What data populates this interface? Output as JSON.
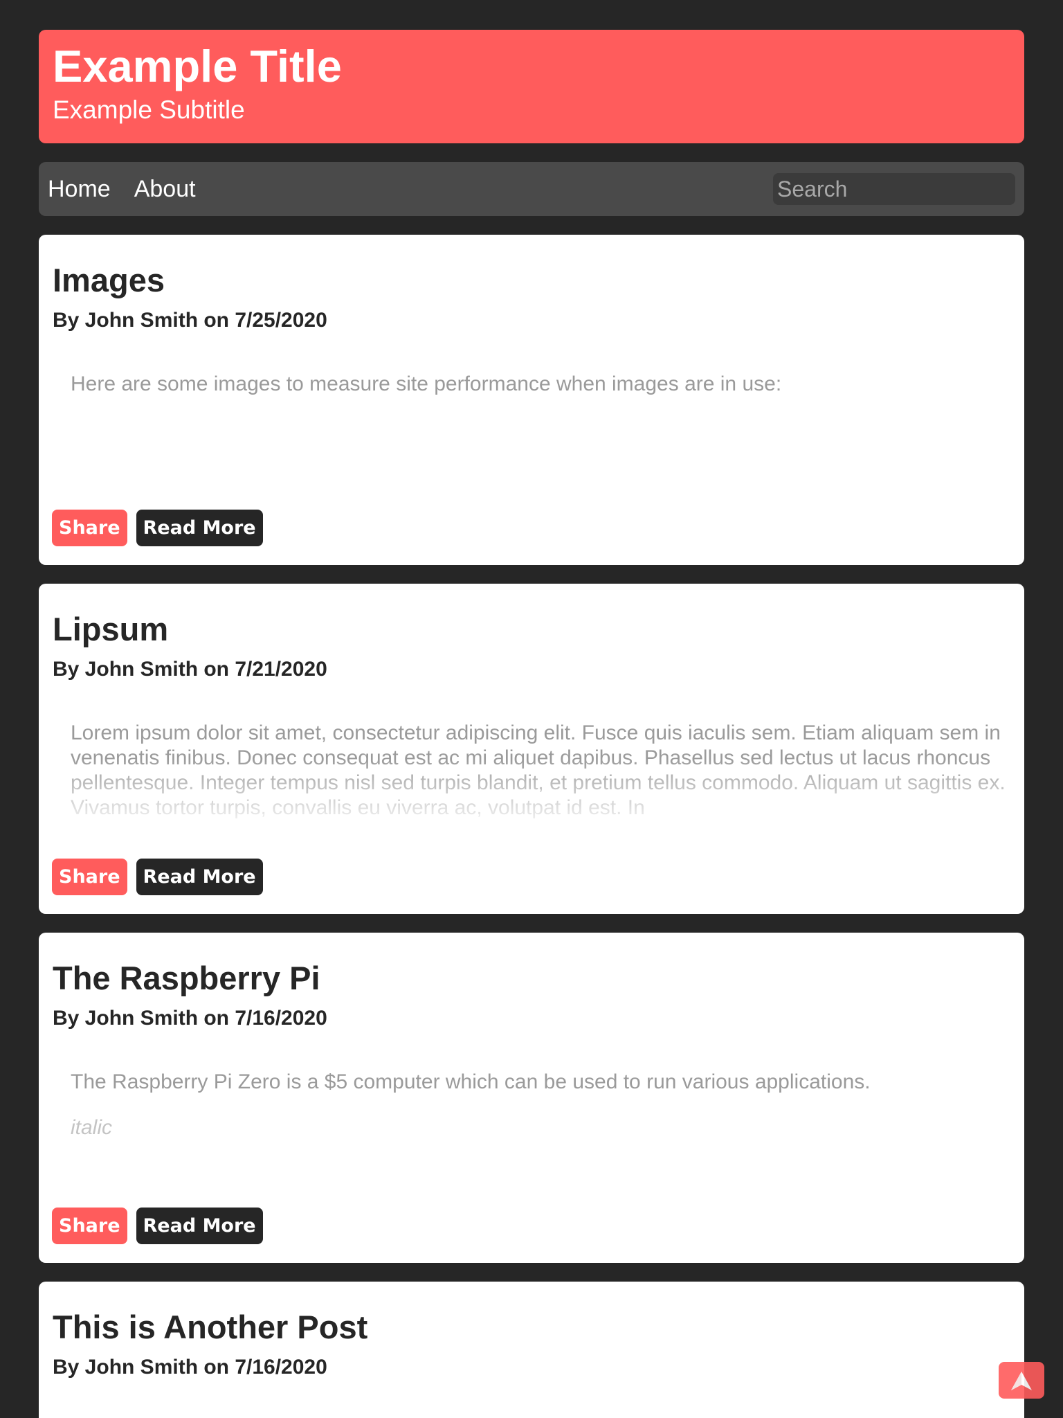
{
  "header": {
    "title": "Example Title",
    "subtitle": "Example Subtitle"
  },
  "nav": {
    "links": [
      "Home",
      "About"
    ],
    "search_placeholder": "Search"
  },
  "posts": [
    {
      "title": "Images",
      "byline": "By John Smith on 7/25/2020",
      "body": "Here are some images to measure site performance when images are in use:",
      "extra": ""
    },
    {
      "title": "Lipsum",
      "byline": "By John Smith on 7/21/2020",
      "body": "Lorem ipsum dolor sit amet, consectetur adipiscing elit. Fusce quis iaculis sem. Etiam aliquam sem in venenatis finibus. Donec consequat est ac mi aliquet dapibus. Phasellus sed lectus ut lacus rhoncus pellentesque. Integer tempus nisl sed turpis blandit, et pretium tellus commodo. Aliquam ut sagittis ex. Vivamus tortor turpis, convallis eu viverra ac, volutpat id est. In",
      "extra": ""
    },
    {
      "title": "The Raspberry Pi",
      "byline": "By John Smith on 7/16/2020",
      "body": "The Raspberry Pi Zero is a $5 computer which can be used to run various applications.",
      "extra": "italic"
    },
    {
      "title": "This is Another Post",
      "byline": "By John Smith on 7/16/2020",
      "body": "",
      "extra": ""
    }
  ],
  "buttons": {
    "share": "Share",
    "read_more": "Read More"
  },
  "scroll_top_icon": "arrow-up-icon",
  "colors": {
    "accent": "#ff5c5c",
    "background": "#262626",
    "navbar": "#4a4a4a"
  }
}
